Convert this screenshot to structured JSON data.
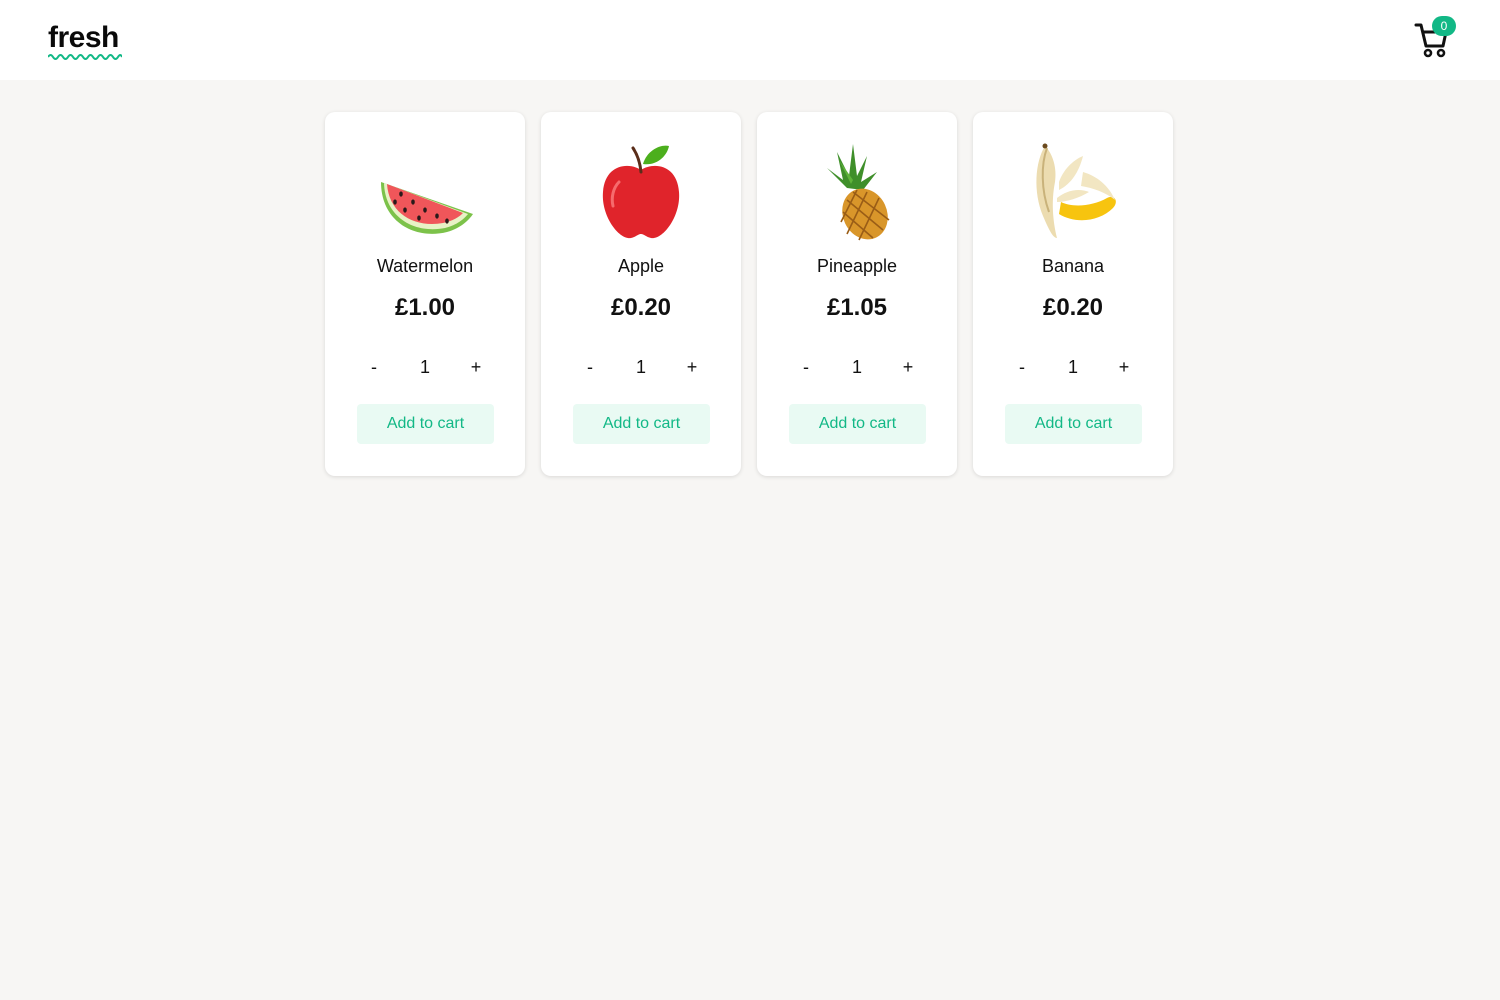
{
  "header": {
    "logo_text": "fresh",
    "cart_count": "0",
    "cart_icon": "shopping-cart-icon"
  },
  "colors": {
    "accent": "#12b886",
    "button_bg": "#e9faf3",
    "page_bg": "#f7f6f4",
    "card_bg": "#ffffff"
  },
  "products": [
    {
      "name": "Watermelon",
      "price": "£1.00",
      "quantity": "1",
      "icon": "watermelon-icon",
      "decrement": "-",
      "increment": "+",
      "add_label": "Add to cart"
    },
    {
      "name": "Apple",
      "price": "£0.20",
      "quantity": "1",
      "icon": "apple-icon",
      "decrement": "-",
      "increment": "+",
      "add_label": "Add to cart"
    },
    {
      "name": "Pineapple",
      "price": "£1.05",
      "quantity": "1",
      "icon": "pineapple-icon",
      "decrement": "-",
      "increment": "+",
      "add_label": "Add to cart"
    },
    {
      "name": "Banana",
      "price": "£0.20",
      "quantity": "1",
      "icon": "banana-icon",
      "decrement": "-",
      "increment": "+",
      "add_label": "Add to cart"
    }
  ]
}
